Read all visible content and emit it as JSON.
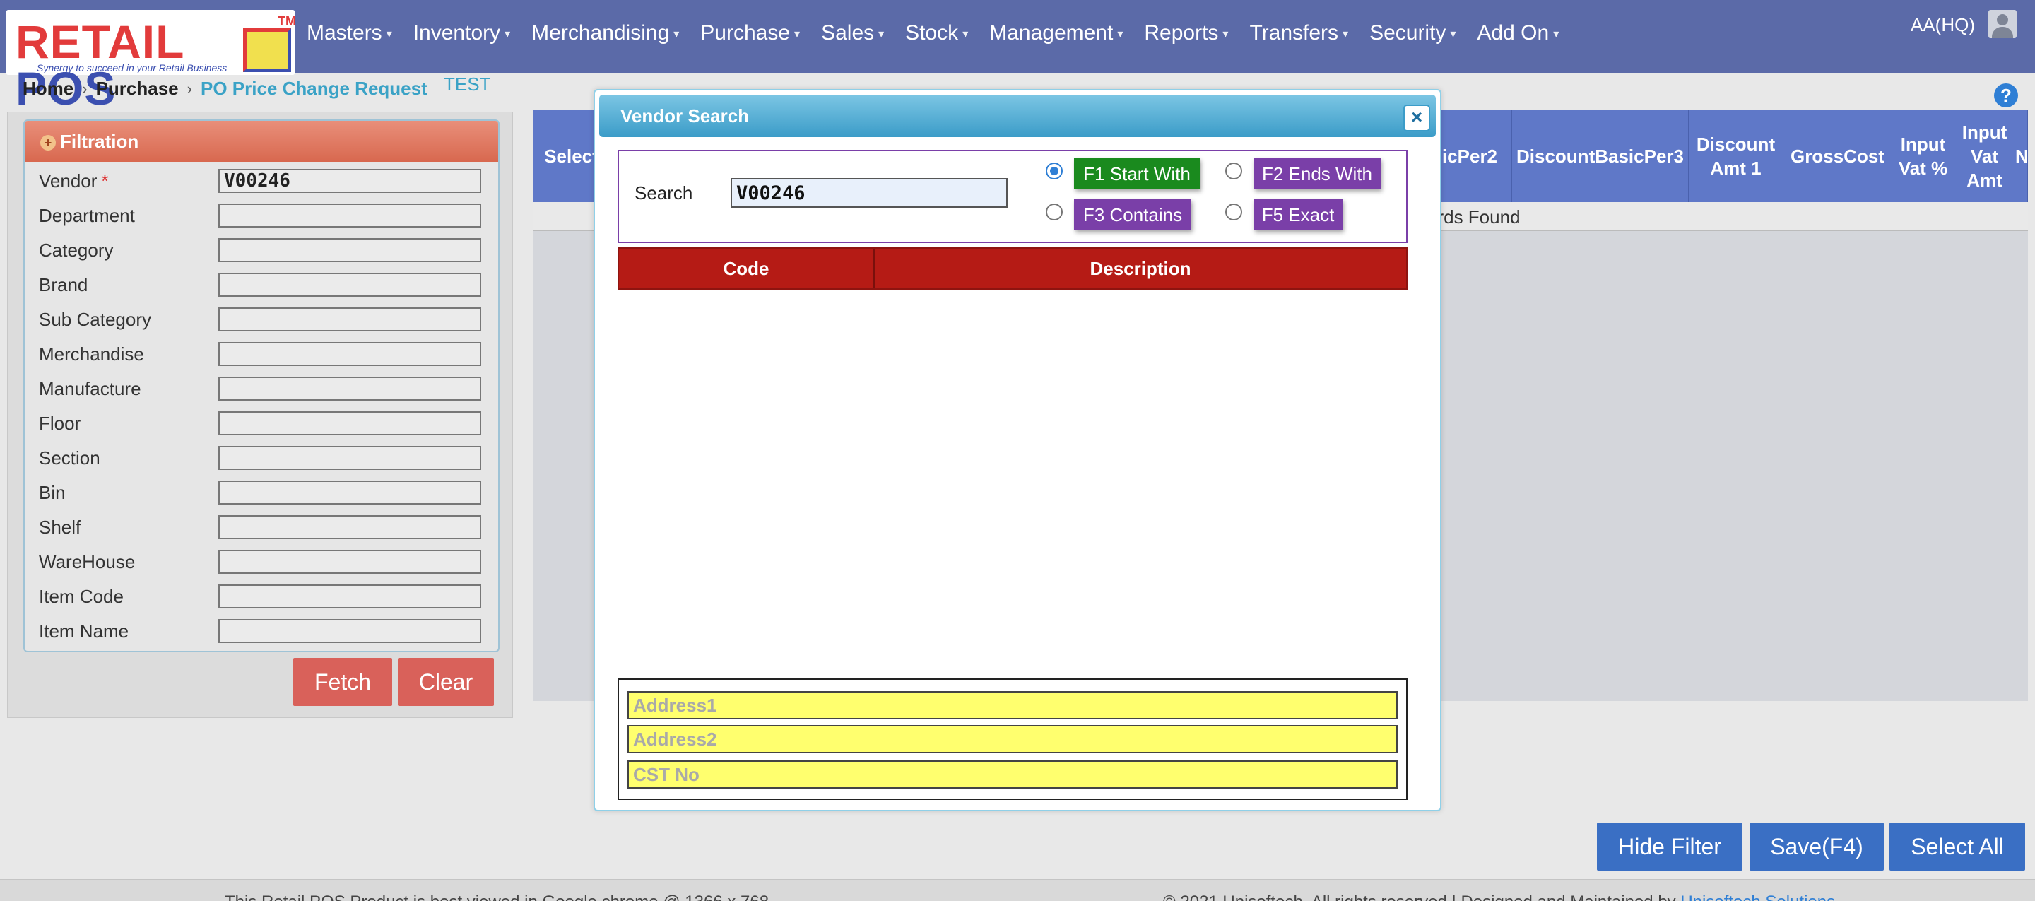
{
  "logo": {
    "word_red": "RETAIL",
    "word_blue": "POS",
    "tm": "TM",
    "tagline": "Synergy to succeed in your Retail Business"
  },
  "nav": {
    "menu": [
      "Masters",
      "Inventory",
      "Merchandising",
      "Purchase",
      "Sales",
      "Stock",
      "Management",
      "Reports",
      "Transfers",
      "Security",
      "Add On"
    ],
    "user": "AA(HQ)"
  },
  "breadcrumb": {
    "home": "Home",
    "section": "Purchase",
    "current": "PO Price Change Request"
  },
  "env_label": "TEST",
  "filter": {
    "title": "Filtration",
    "fields": [
      {
        "label": "Vendor",
        "required": true,
        "value": "V00246"
      },
      {
        "label": "Department",
        "value": ""
      },
      {
        "label": "Category",
        "value": ""
      },
      {
        "label": "Brand",
        "value": ""
      },
      {
        "label": "Sub Category",
        "value": ""
      },
      {
        "label": "Merchandise",
        "value": ""
      },
      {
        "label": "Manufacture",
        "value": ""
      },
      {
        "label": "Floor",
        "value": ""
      },
      {
        "label": "Section",
        "value": ""
      },
      {
        "label": "Bin",
        "value": ""
      },
      {
        "label": "Shelf",
        "value": ""
      },
      {
        "label": "WareHouse",
        "value": ""
      },
      {
        "label": "Item Code",
        "value": ""
      },
      {
        "label": "Item Name",
        "value": ""
      }
    ],
    "required_mark": "*",
    "fetch": "Fetch",
    "clear": "Clear"
  },
  "grid": {
    "columns": [
      "Select",
      "icPer2",
      "DiscountBasicPer3",
      "Discount Amt 1",
      "GrossCost",
      "Input Vat %",
      "Input Vat Amt",
      "N"
    ],
    "empty_text": "ords Found"
  },
  "actions": {
    "hide_filter": "Hide Filter",
    "save": "Save(F4)",
    "select_all": "Select All"
  },
  "footer": {
    "left": "This Retail POS Product is best viewed in Google chrome @ 1366 x 768",
    "right": "© 2021 Unisoftech. All rights reserved | Designed and Maintained by ",
    "right_link": "Unisoftech Solutions"
  },
  "modal": {
    "title": "Vendor Search",
    "close": "×",
    "search_label": "Search",
    "search_value": "V00246",
    "options": [
      {
        "label": "F1 Start With",
        "selected": true
      },
      {
        "label": "F2 Ends With",
        "selected": false
      },
      {
        "label": "F3 Contains",
        "selected": false
      },
      {
        "label": "F5 Exact",
        "selected": false
      }
    ],
    "columns": [
      "Code",
      "Description"
    ],
    "address1": "Address1",
    "address2": "Address2",
    "cst": "CST No"
  },
  "colors": {
    "navbar": "#5b6aa8",
    "grid_header": "#5f78c8",
    "result_header": "#b51b15",
    "option_selected": "#1a8a1e",
    "option_default": "#7a3fa8",
    "button_blue": "#3a6fc4",
    "button_red": "#d9615a"
  },
  "icons": [
    "caret-down-icon",
    "user-avatar-icon",
    "help-icon",
    "expand-plus-icon",
    "close-icon"
  ]
}
